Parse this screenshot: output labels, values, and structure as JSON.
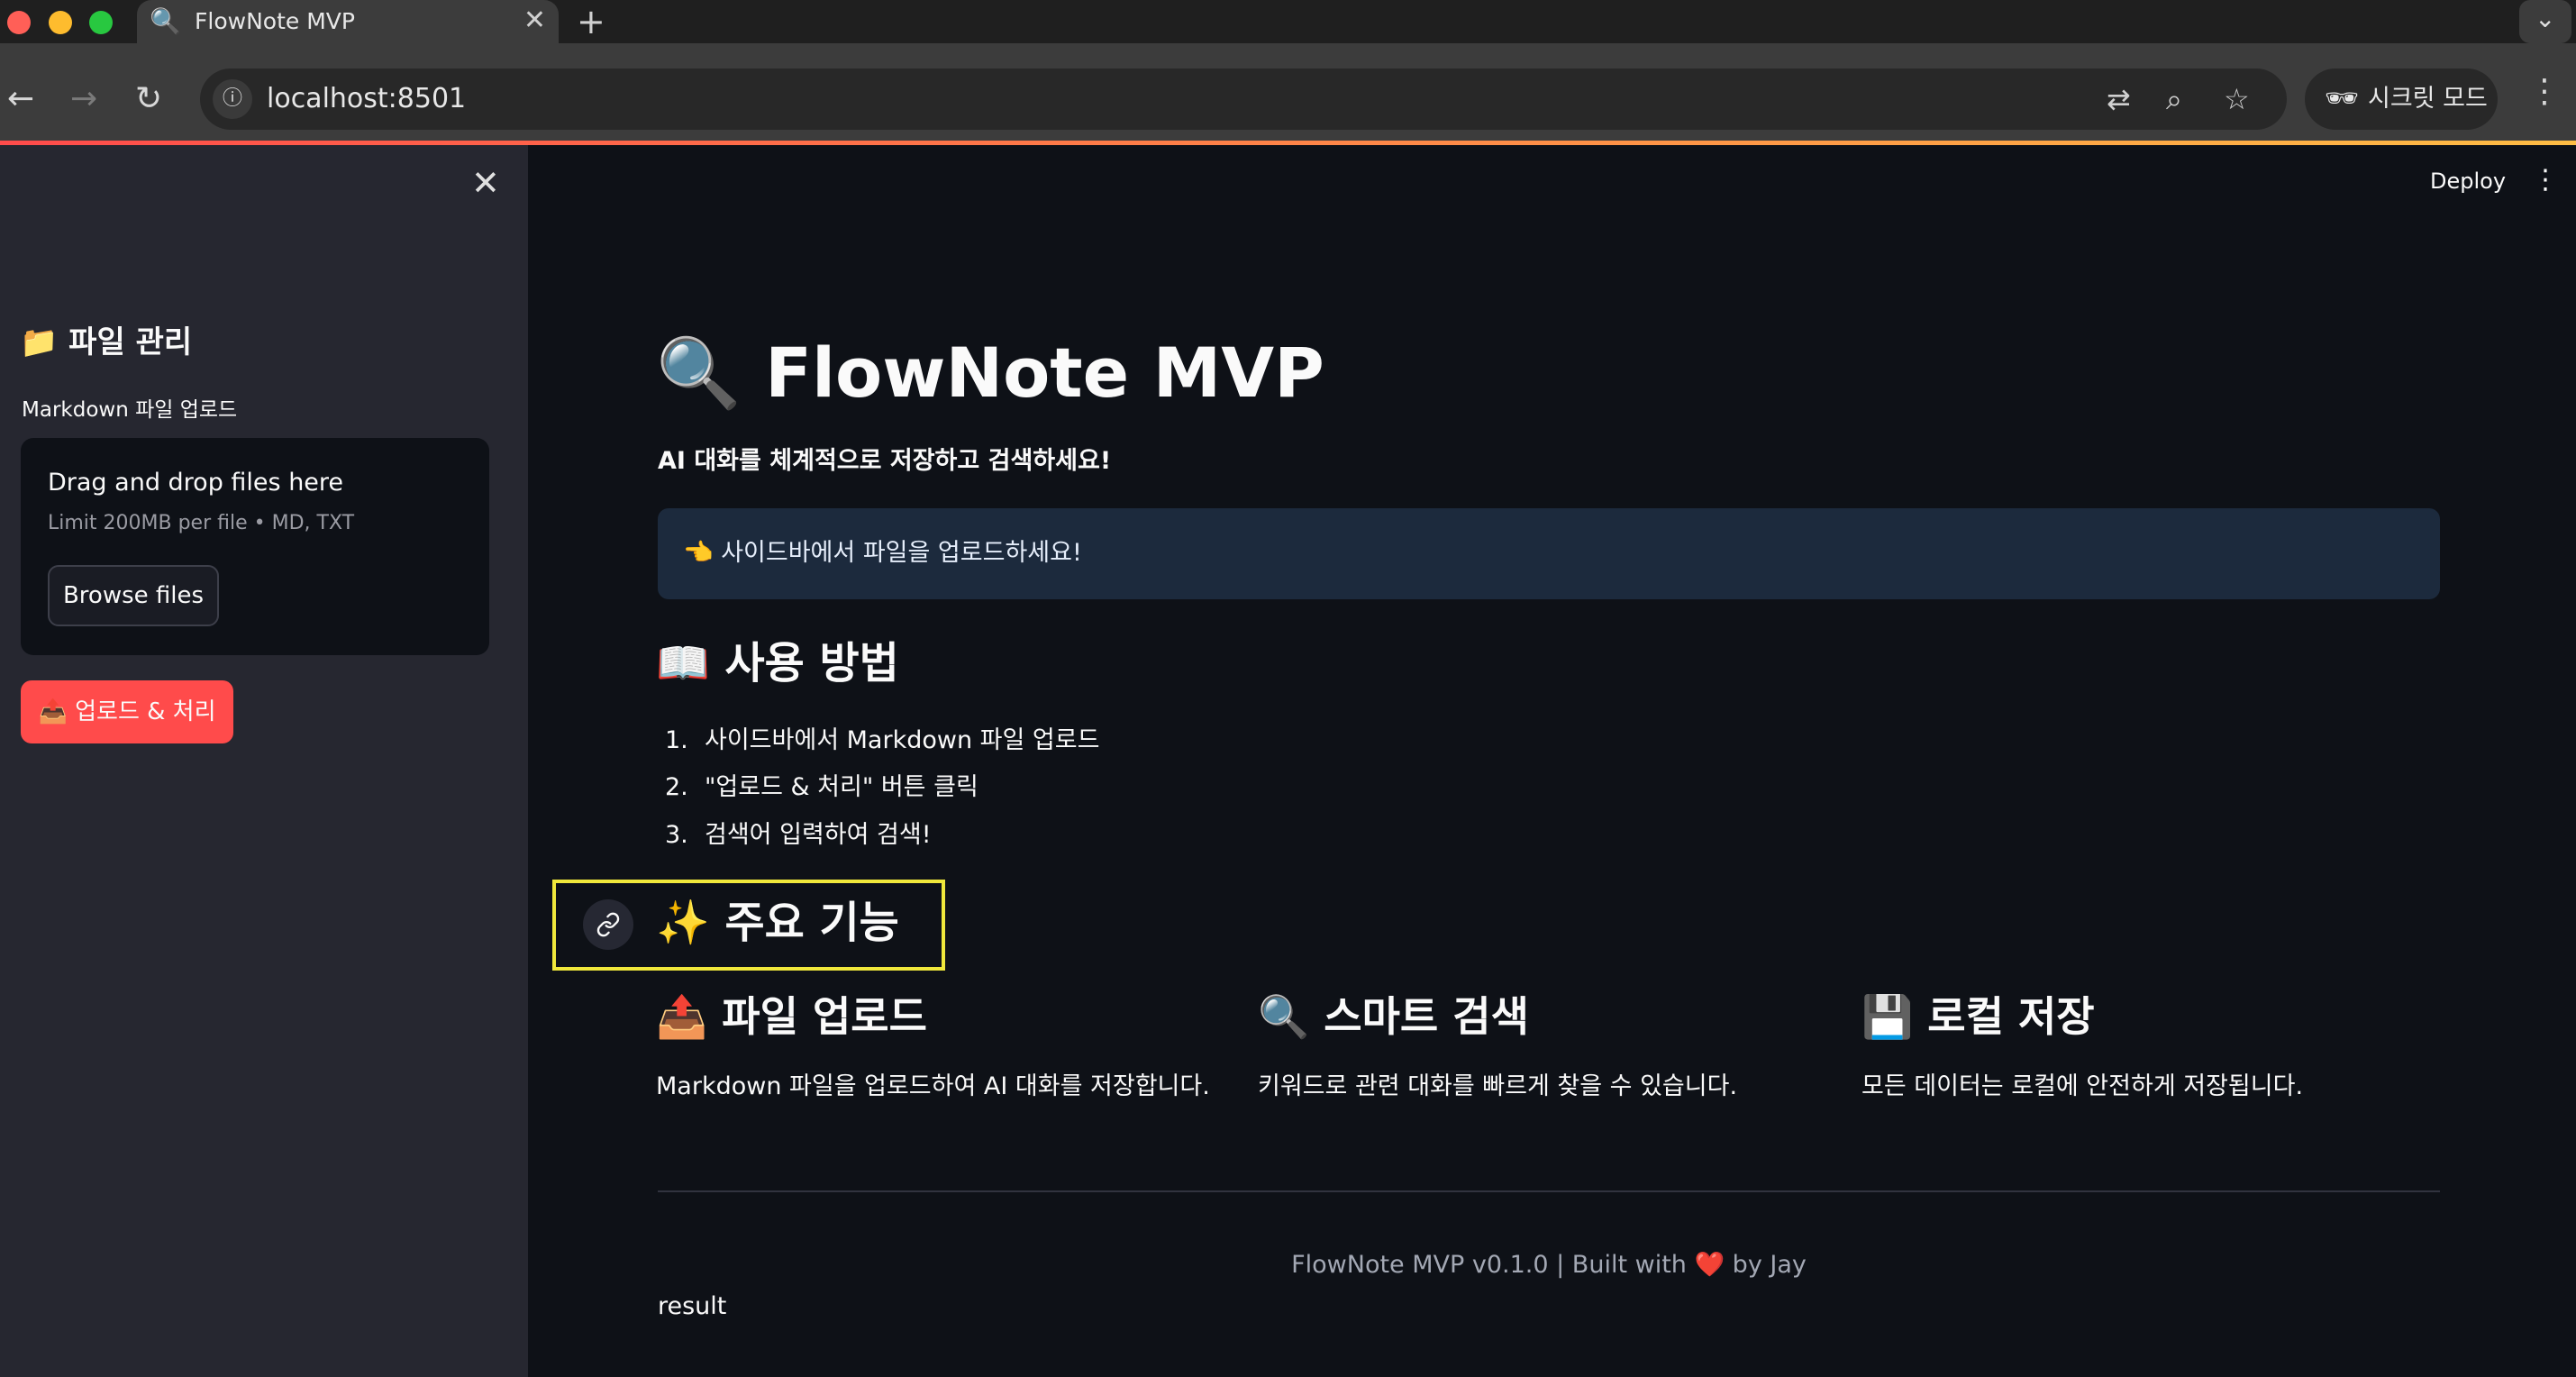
{
  "browser": {
    "tab_icon": "🔍",
    "tab_title": "FlowNote MVP",
    "tab_close": "✕",
    "new_tab": "+",
    "tab_menu": "⌄",
    "back": "←",
    "forward": "→",
    "reload": "↻",
    "site_info": "ⓘ",
    "url": "localhost:8501",
    "translate_icon": "⇄",
    "zoom_icon": "⌕",
    "star_icon": "☆",
    "incognito_label": "시크릿 모드",
    "incognito_icon": "🕶",
    "menu": "⋮"
  },
  "sidebar": {
    "close": "✕",
    "title": "📁 파일 관리",
    "upload_label": "Markdown 파일 업로드",
    "dropzone_title": "Drag and drop files here",
    "dropzone_limit": "Limit 200MB per file • MD, TXT",
    "browse_button": "Browse files",
    "upload_button": "📤 업로드 & 처리"
  },
  "header": {
    "deploy": "Deploy",
    "menu": "⋮"
  },
  "main": {
    "title": "🔍 FlowNote MVP",
    "subtitle": "AI 대화를 체계적으로 저장하고 검색하세요!",
    "info": "👈 사이드바에서 파일을 업로드하세요!",
    "usage_heading": "📖 사용 방법",
    "steps": [
      {
        "num": "1.",
        "text": "사이드바에서 Markdown 파일 업로드"
      },
      {
        "num": "2.",
        "text": "\"업로드 & 처리\" 버튼 클릭"
      },
      {
        "num": "3.",
        "text": "검색어 입력하여 검색!"
      }
    ],
    "features_heading": "✨ 주요 기능",
    "features": [
      {
        "title": "📤 파일 업로드",
        "desc": "Markdown 파일을 업로드하여 AI 대화를 저장합니다."
      },
      {
        "title": "🔍 스마트 검색",
        "desc": "키워드로 관련 대화를 빠르게 찾을 수 있습니다."
      },
      {
        "title": "💾 로컬 저장",
        "desc": "모든 데이터는 로컬에 안전하게 저장됩니다."
      }
    ],
    "footer": "FlowNote MVP v0.1.0 | Built with ❤️ by Jay",
    "result": "result"
  },
  "colors": {
    "background": "#0e1117",
    "sidebar": "#262730",
    "primary_button": "#ff4b4b",
    "info_box": "#1c2a3d",
    "highlight": "#f0e83b"
  }
}
